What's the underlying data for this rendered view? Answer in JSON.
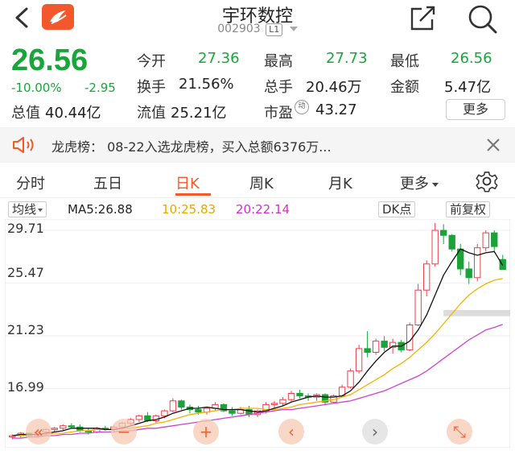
{
  "header": {
    "title": "宇环数控",
    "code": "002903",
    "market_badge": "L1"
  },
  "quote": {
    "price": "26.56",
    "change_pct": "-10.00%",
    "change_amt": "-2.95",
    "open_label": "今开",
    "open_value": "27.36",
    "high_label": "最高",
    "high_value": "27.73",
    "low_label": "最低",
    "low_value": "26.56",
    "turnover_label": "换手",
    "turnover_value": "21.56%",
    "volume_label": "总手",
    "volume_value": "20.46万",
    "amount_label": "金额",
    "amount_value": "5.47亿",
    "total_cap_label": "总值",
    "total_cap_value": "40.44亿",
    "float_cap_label": "流值",
    "float_cap_value": "25.21亿",
    "pe_label": "市盈",
    "pe_badge": "动",
    "pe_value": "43.27",
    "more_label": "更多"
  },
  "notice": {
    "text": "龙虎榜： 08-22入选龙虎榜，买入总额6376万..."
  },
  "tabs": [
    {
      "label": "分时"
    },
    {
      "label": "五日"
    },
    {
      "label": "日K"
    },
    {
      "label": "周K"
    },
    {
      "label": "月K"
    },
    {
      "label": "更多"
    }
  ],
  "ma_bar": {
    "indicator_label": "均线",
    "ma5": "MA5:26.88",
    "ma10": "10:25.83",
    "ma20": "20:22.14",
    "dk_label": "DK点",
    "adjust_label": "前复权"
  },
  "chart_data": {
    "type": "candlestick",
    "y_ticks": [
      "29.71",
      "25.47",
      "21.23",
      "16.99"
    ],
    "ylim": [
      12.75,
      30.35
    ],
    "colors": {
      "up": "#e8414a",
      "down": "#1ba33a",
      "ma5": "#111111",
      "ma10": "#f0b400",
      "ma20": "#cc44cc"
    },
    "candles": [
      [
        13.1,
        13.3,
        12.9,
        13.2
      ],
      [
        13.2,
        13.5,
        13.0,
        13.4
      ],
      [
        13.4,
        13.4,
        13.1,
        13.2
      ],
      [
        13.2,
        13.6,
        13.1,
        13.5
      ],
      [
        13.5,
        13.8,
        13.4,
        13.7
      ],
      [
        13.7,
        13.9,
        13.5,
        13.8
      ],
      [
        13.8,
        14.1,
        13.6,
        14.0
      ],
      [
        14.0,
        14.2,
        13.8,
        13.9
      ],
      [
        13.9,
        14.1,
        13.5,
        13.6
      ],
      [
        13.6,
        13.8,
        13.3,
        13.5
      ],
      [
        13.5,
        13.9,
        13.4,
        13.8
      ],
      [
        13.8,
        14.0,
        13.6,
        13.7
      ],
      [
        13.7,
        14.0,
        13.5,
        13.9
      ],
      [
        13.9,
        14.3,
        13.8,
        14.2
      ],
      [
        14.2,
        14.6,
        14.0,
        14.5
      ],
      [
        14.5,
        14.9,
        14.3,
        14.8
      ],
      [
        14.8,
        15.1,
        14.3,
        14.4
      ],
      [
        14.4,
        14.9,
        14.2,
        14.8
      ],
      [
        14.8,
        15.3,
        14.6,
        15.2
      ],
      [
        15.2,
        16.2,
        15.1,
        16.0
      ],
      [
        16.0,
        16.1,
        15.3,
        15.5
      ],
      [
        15.5,
        15.7,
        15.0,
        15.3
      ],
      [
        15.3,
        15.6,
        14.9,
        15.1
      ],
      [
        15.1,
        15.5,
        14.9,
        15.4
      ],
      [
        15.4,
        15.9,
        15.2,
        15.7
      ],
      [
        15.7,
        15.8,
        15.1,
        15.2
      ],
      [
        15.2,
        15.5,
        14.8,
        15.0
      ],
      [
        15.0,
        15.5,
        14.9,
        15.3
      ],
      [
        15.3,
        15.6,
        14.7,
        14.9
      ],
      [
        14.9,
        15.3,
        14.7,
        15.2
      ],
      [
        15.2,
        15.9,
        15.0,
        15.7
      ],
      [
        15.7,
        16.0,
        15.4,
        15.8
      ],
      [
        15.8,
        16.3,
        15.6,
        16.1
      ],
      [
        16.1,
        16.8,
        15.9,
        16.6
      ],
      [
        16.6,
        16.9,
        16.2,
        16.4
      ],
      [
        16.4,
        16.6,
        16.0,
        16.3
      ],
      [
        16.3,
        16.6,
        16.0,
        16.5
      ],
      [
        16.5,
        16.6,
        15.7,
        15.9
      ],
      [
        15.9,
        16.5,
        15.8,
        16.4
      ],
      [
        16.4,
        17.3,
        16.3,
        17.1
      ],
      [
        17.1,
        18.6,
        17.0,
        18.4
      ],
      [
        18.4,
        20.5,
        18.2,
        20.2
      ],
      [
        20.2,
        21.6,
        19.5,
        19.9
      ],
      [
        19.9,
        21.0,
        19.7,
        20.8
      ],
      [
        20.8,
        21.2,
        20.0,
        20.3
      ],
      [
        20.3,
        21.0,
        19.8,
        20.7
      ],
      [
        20.7,
        20.9,
        19.9,
        20.1
      ],
      [
        20.1,
        22.3,
        20.0,
        22.1
      ],
      [
        22.1,
        25.4,
        22.0,
        24.9
      ],
      [
        24.9,
        27.3,
        24.4,
        27.0
      ],
      [
        27.0,
        30.3,
        26.8,
        29.7
      ],
      [
        29.7,
        30.2,
        28.6,
        29.3
      ],
      [
        29.3,
        29.4,
        28.0,
        28.2
      ],
      [
        28.2,
        28.6,
        26.1,
        26.6
      ],
      [
        26.6,
        27.2,
        25.4,
        25.9
      ],
      [
        25.9,
        28.6,
        25.6,
        28.3
      ],
      [
        28.3,
        29.7,
        28.0,
        29.5
      ],
      [
        29.5,
        29.7,
        27.9,
        28.4
      ],
      [
        27.36,
        27.73,
        26.56,
        26.56
      ]
    ],
    "ma5": [
      13.2,
      13.3,
      13.3,
      13.3,
      13.4,
      13.5,
      13.6,
      13.8,
      13.8,
      13.8,
      13.8,
      13.7,
      13.7,
      13.8,
      14.0,
      14.2,
      14.4,
      14.5,
      14.7,
      15.0,
      15.2,
      15.4,
      15.4,
      15.5,
      15.4,
      15.3,
      15.3,
      15.3,
      15.2,
      15.1,
      15.2,
      15.4,
      15.6,
      15.9,
      16.1,
      16.3,
      16.4,
      16.3,
      16.3,
      16.4,
      16.8,
      17.5,
      18.4,
      19.2,
      19.9,
      20.4,
      20.4,
      20.8,
      21.7,
      22.9,
      24.5,
      26.1,
      27.2,
      28.2,
      27.9,
      27.7,
      27.9,
      28.0,
      26.88
    ],
    "ma10": [
      13.2,
      13.2,
      13.3,
      13.3,
      13.3,
      13.4,
      13.4,
      13.5,
      13.6,
      13.6,
      13.7,
      13.7,
      13.7,
      13.8,
      13.8,
      13.9,
      14.0,
      14.2,
      14.3,
      14.5,
      14.7,
      14.9,
      15.0,
      15.1,
      15.2,
      15.3,
      15.3,
      15.4,
      15.4,
      15.4,
      15.3,
      15.3,
      15.4,
      15.5,
      15.7,
      15.8,
      15.9,
      16.0,
      16.1,
      16.3,
      16.5,
      16.9,
      17.3,
      17.7,
      18.1,
      18.6,
      19.0,
      19.5,
      20.1,
      20.7,
      21.4,
      22.2,
      23.0,
      23.8,
      24.5,
      25.0,
      25.4,
      25.7,
      25.83
    ],
    "ma20": [
      13.0,
      13.0,
      13.1,
      13.1,
      13.2,
      13.2,
      13.3,
      13.3,
      13.4,
      13.4,
      13.5,
      13.5,
      13.5,
      13.6,
      13.6,
      13.7,
      13.8,
      13.8,
      13.9,
      14.0,
      14.1,
      14.2,
      14.3,
      14.4,
      14.5,
      14.6,
      14.7,
      14.8,
      14.9,
      15.0,
      15.1,
      15.2,
      15.3,
      15.3,
      15.4,
      15.5,
      15.6,
      15.7,
      15.8,
      15.9,
      16.0,
      16.2,
      16.4,
      16.6,
      16.8,
      17.1,
      17.4,
      17.7,
      18.0,
      18.4,
      18.9,
      19.4,
      19.9,
      20.4,
      20.9,
      21.3,
      21.7,
      21.9,
      22.14
    ],
    "zone": [
      22.8,
      23.3
    ]
  }
}
